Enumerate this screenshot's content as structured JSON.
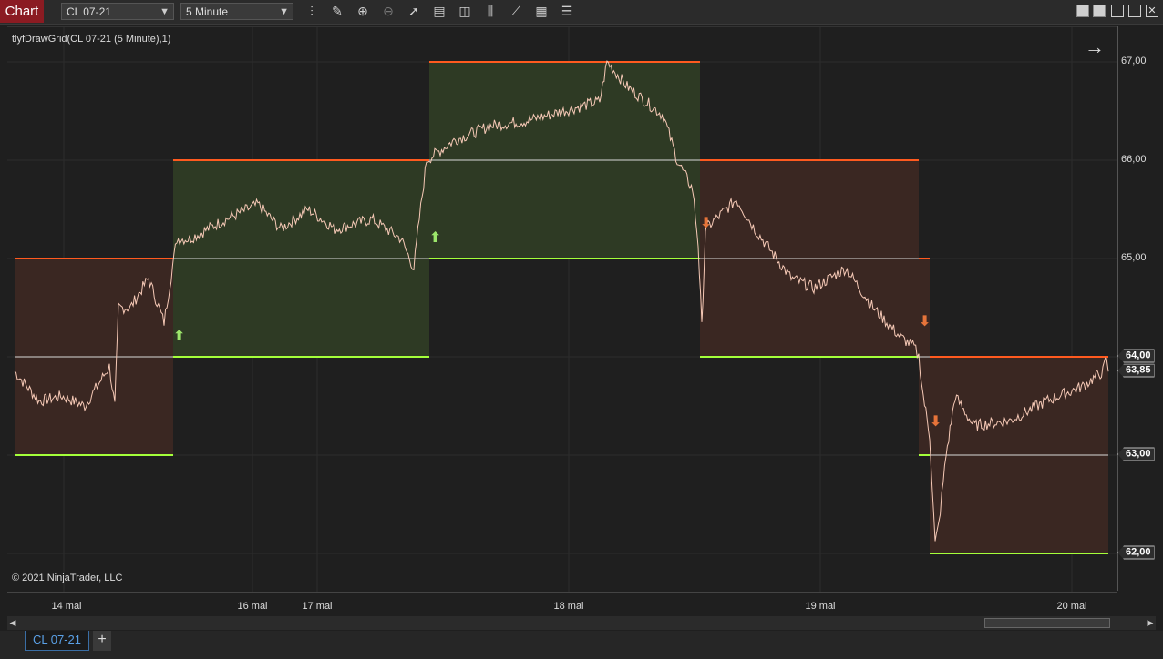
{
  "toolbar": {
    "chart_tab": "Chart",
    "instrument": "CL 07-21",
    "interval": "5 Minute",
    "tools": [
      "bar-style-icon",
      "pencil-icon",
      "zoom-in-icon",
      "zoom-out-icon",
      "pointer-icon",
      "data-box-icon",
      "properties-icon",
      "indicators-icon",
      "strategies-icon",
      "drawing-tools-icon",
      "chart-trader-icon"
    ]
  },
  "indicator_label": "tlyfDrawGrid(CL 07-21 (5 Minute),1)",
  "copyright": "© 2021 NinjaTrader, LLC",
  "price_axis": {
    "labels": [
      "67,00",
      "66,00",
      "65,00",
      "64,00",
      "63,85",
      "63,00",
      "62,00"
    ],
    "tagged": [
      "64,00",
      "63,85",
      "63,00",
      "62,00"
    ]
  },
  "date_axis": [
    "14 mai",
    "16 mai",
    "17 mai",
    "18 mai",
    "19 mai",
    "20 mai"
  ],
  "bottom_tab": {
    "label": "CL 07-21",
    "add": "+"
  },
  "chart_data": {
    "type": "line",
    "y_range": [
      61.6,
      67.3
    ],
    "x_labels": [
      "14 mai",
      "16 mai",
      "17 mai",
      "18 mai",
      "19 mai",
      "20 mai"
    ],
    "grid": true,
    "last_price": 63.85,
    "grid_boxes": [
      {
        "from": "13 mai",
        "to": "15 mai",
        "low": 63.0,
        "high": 65.0,
        "mid": 64.0,
        "trend": "down"
      },
      {
        "from": "15 mai",
        "to": "17 mai",
        "low": 64.0,
        "high": 66.0,
        "mid": 65.0,
        "trend": "up"
      },
      {
        "from": "17 mai",
        "to": "18 mai",
        "low": 65.0,
        "high": 67.0,
        "mid": 66.0,
        "trend": "up"
      },
      {
        "from": "18 mai",
        "to": "19 mai",
        "low": 64.0,
        "high": 66.0,
        "mid": 65.0,
        "trend": "down"
      },
      {
        "from": "19 mai",
        "to": "19 mai",
        "low": 63.0,
        "high": 65.0,
        "mid": 64.0,
        "trend": "down"
      },
      {
        "from": "19 mai",
        "to": "20 mai",
        "low": 62.0,
        "high": 64.0,
        "mid": 63.0,
        "trend": "down"
      }
    ],
    "colors": {
      "up_fill": "#2e3a24",
      "down_fill": "#3a2722",
      "upper_line": "#ff5a1f",
      "lower_line": "#a4ff3a",
      "price": "#f6c9b6",
      "up_arrow": "#9ce66b",
      "down_arrow": "#e7743a"
    }
  }
}
